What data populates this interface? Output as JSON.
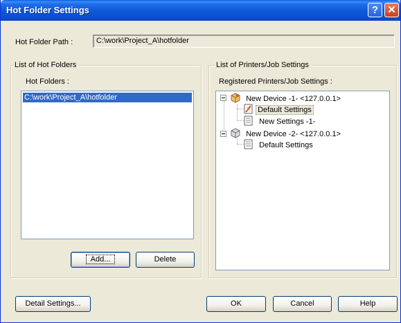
{
  "window": {
    "title": "Hot Folder Settings",
    "help_glyph": "?",
    "close_glyph": "✕"
  },
  "path": {
    "label": "Hot Folder Path :",
    "value": "C:\\work\\Project_A\\hotfolder"
  },
  "hot_folders_group": {
    "title": "List of Hot Folders",
    "list_label": "Hot Folders :",
    "items": [
      "C:\\work\\Project_A\\hotfolder"
    ],
    "add_button": "Add...",
    "delete_button": "Delete"
  },
  "printers_group": {
    "title": "List of Printers/Job Settings",
    "list_label": "Registered Printers/Job Settings :",
    "tree": [
      {
        "label": "New Device -1- <127.0.0.1>",
        "children": [
          "Default Settings",
          "New Settings -1-"
        ]
      },
      {
        "label": "New Device -2- <127.0.0.1>",
        "children": [
          "Default Settings"
        ]
      }
    ]
  },
  "footer": {
    "detail_button": "Detail Settings...",
    "ok_button": "OK",
    "cancel_button": "Cancel",
    "help_button": "Help"
  },
  "icons": {
    "device_icon": "printer-device-icon",
    "settings_icon": "job-settings-icon",
    "active_settings_icon": "active-job-settings-icon"
  }
}
